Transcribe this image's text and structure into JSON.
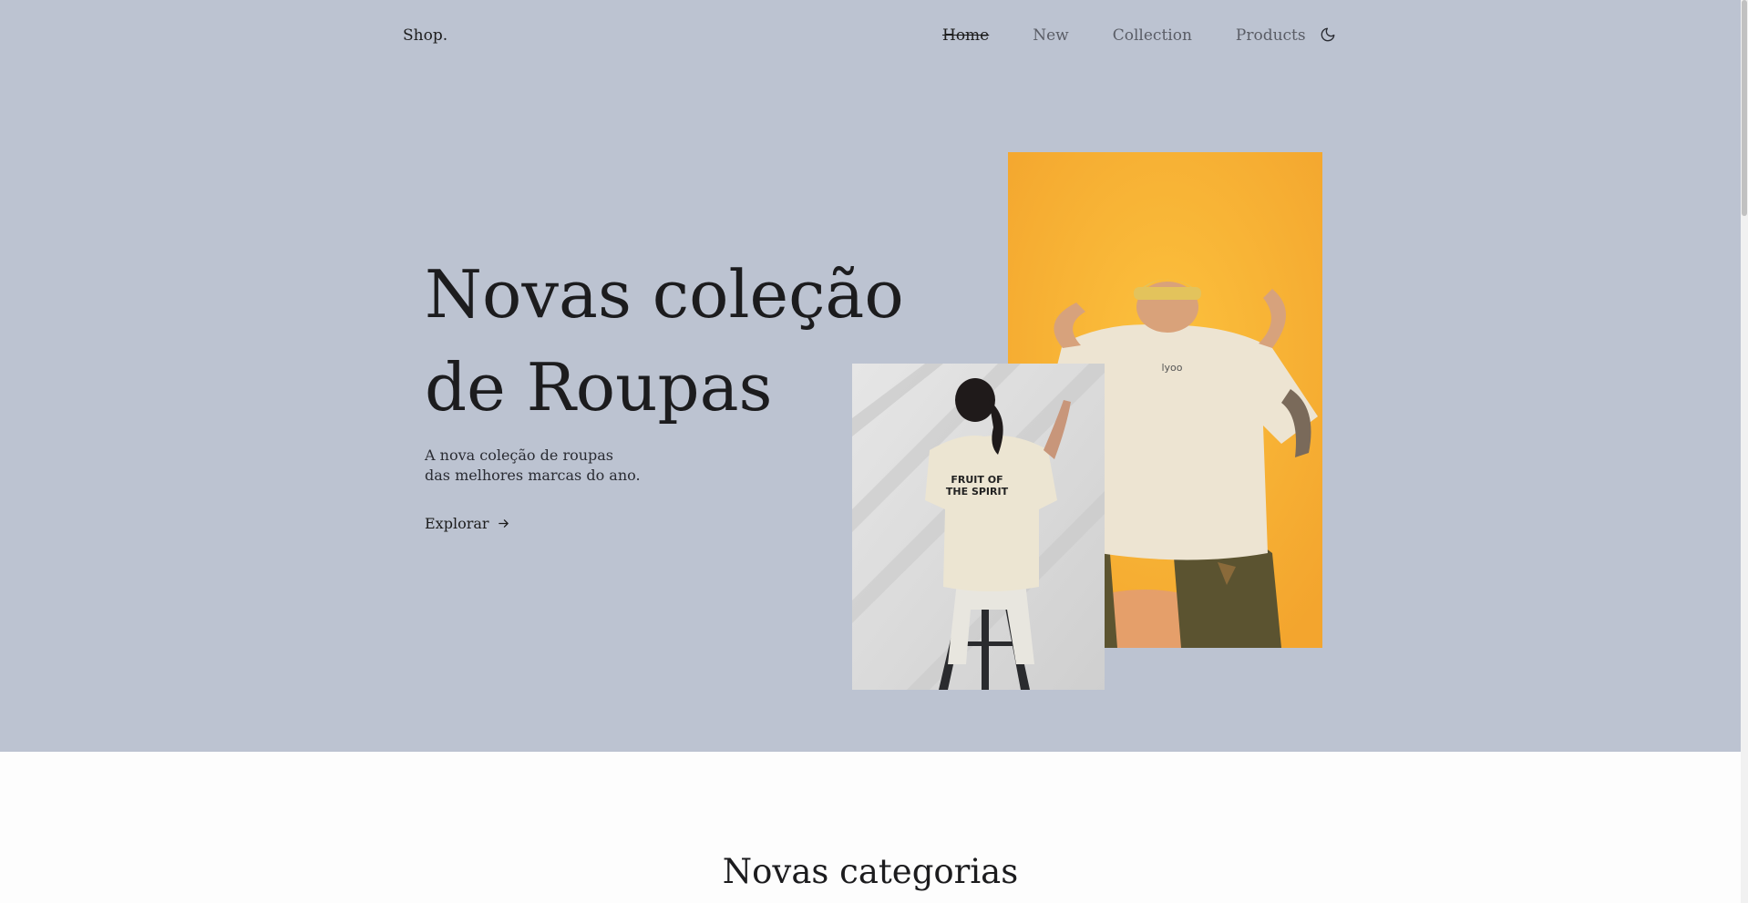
{
  "header": {
    "logo": "Shop.",
    "nav": [
      {
        "label": "Home",
        "active": true
      },
      {
        "label": "New",
        "active": false
      },
      {
        "label": "Collection",
        "active": false
      },
      {
        "label": "Products",
        "active": false
      }
    ],
    "theme_icon": "moon-icon"
  },
  "hero": {
    "title_line1": "Novas coleção",
    "title_line2": "de Roupas",
    "desc_line1": "A nova coleção de roupas",
    "desc_line2": "das melhores marcas do ano.",
    "cta_label": "Explorar",
    "cta_icon": "arrow-right-icon",
    "photo_yellow_text": "lyoo",
    "photo_white_text_line1": "FRUIT OF",
    "photo_white_text_line2": "THE SPIRIT"
  },
  "sections": {
    "categories_title": "Novas categorias"
  },
  "colors": {
    "hero_bg": "#bcc3d1",
    "page_bg": "#fdfdfd",
    "text_dark": "#1c1c1e",
    "photo_yellow_bg": "#f4ac34"
  }
}
